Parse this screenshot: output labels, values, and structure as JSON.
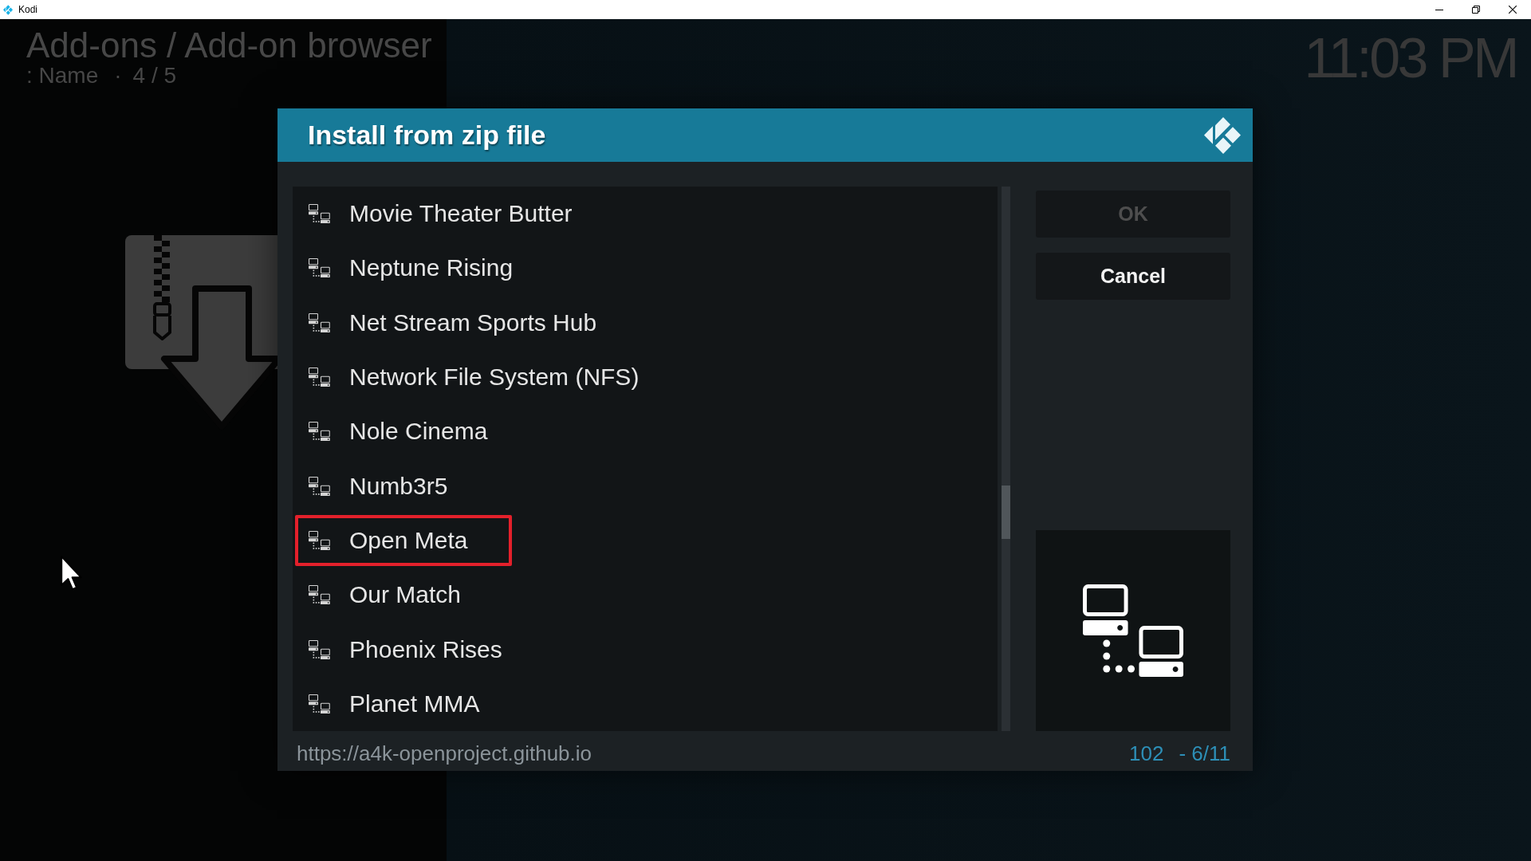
{
  "window": {
    "title": "Kodi"
  },
  "header": {
    "title": "Add-ons / Add-on browser",
    "sort": ": Name",
    "separator": "·",
    "position": "4 / 5"
  },
  "clock": "11:03 PM",
  "dialog": {
    "title": "Install from zip file",
    "items": [
      {
        "label": "Movie Theater Butter",
        "selected": false,
        "outlined": false
      },
      {
        "label": "Neptune Rising",
        "selected": false,
        "outlined": false
      },
      {
        "label": "Net Stream Sports Hub",
        "selected": false,
        "outlined": false
      },
      {
        "label": "Network File System (NFS)",
        "selected": false,
        "outlined": false
      },
      {
        "label": "Nole Cinema",
        "selected": false,
        "outlined": false
      },
      {
        "label": "Numb3r5",
        "selected": false,
        "outlined": false
      },
      {
        "label": "Open Meta",
        "selected": false,
        "outlined": true
      },
      {
        "label": "Our Match",
        "selected": false,
        "outlined": false
      },
      {
        "label": "Phoenix Rises",
        "selected": false,
        "outlined": false
      },
      {
        "label": "Planet MMA",
        "selected": false,
        "outlined": false
      }
    ],
    "buttons": [
      {
        "label": "OK",
        "disabled": true
      },
      {
        "label": "Cancel",
        "disabled": false
      }
    ],
    "path": "https://a4k-openproject.github.io",
    "item_count": "102",
    "page": "- 6/11"
  }
}
